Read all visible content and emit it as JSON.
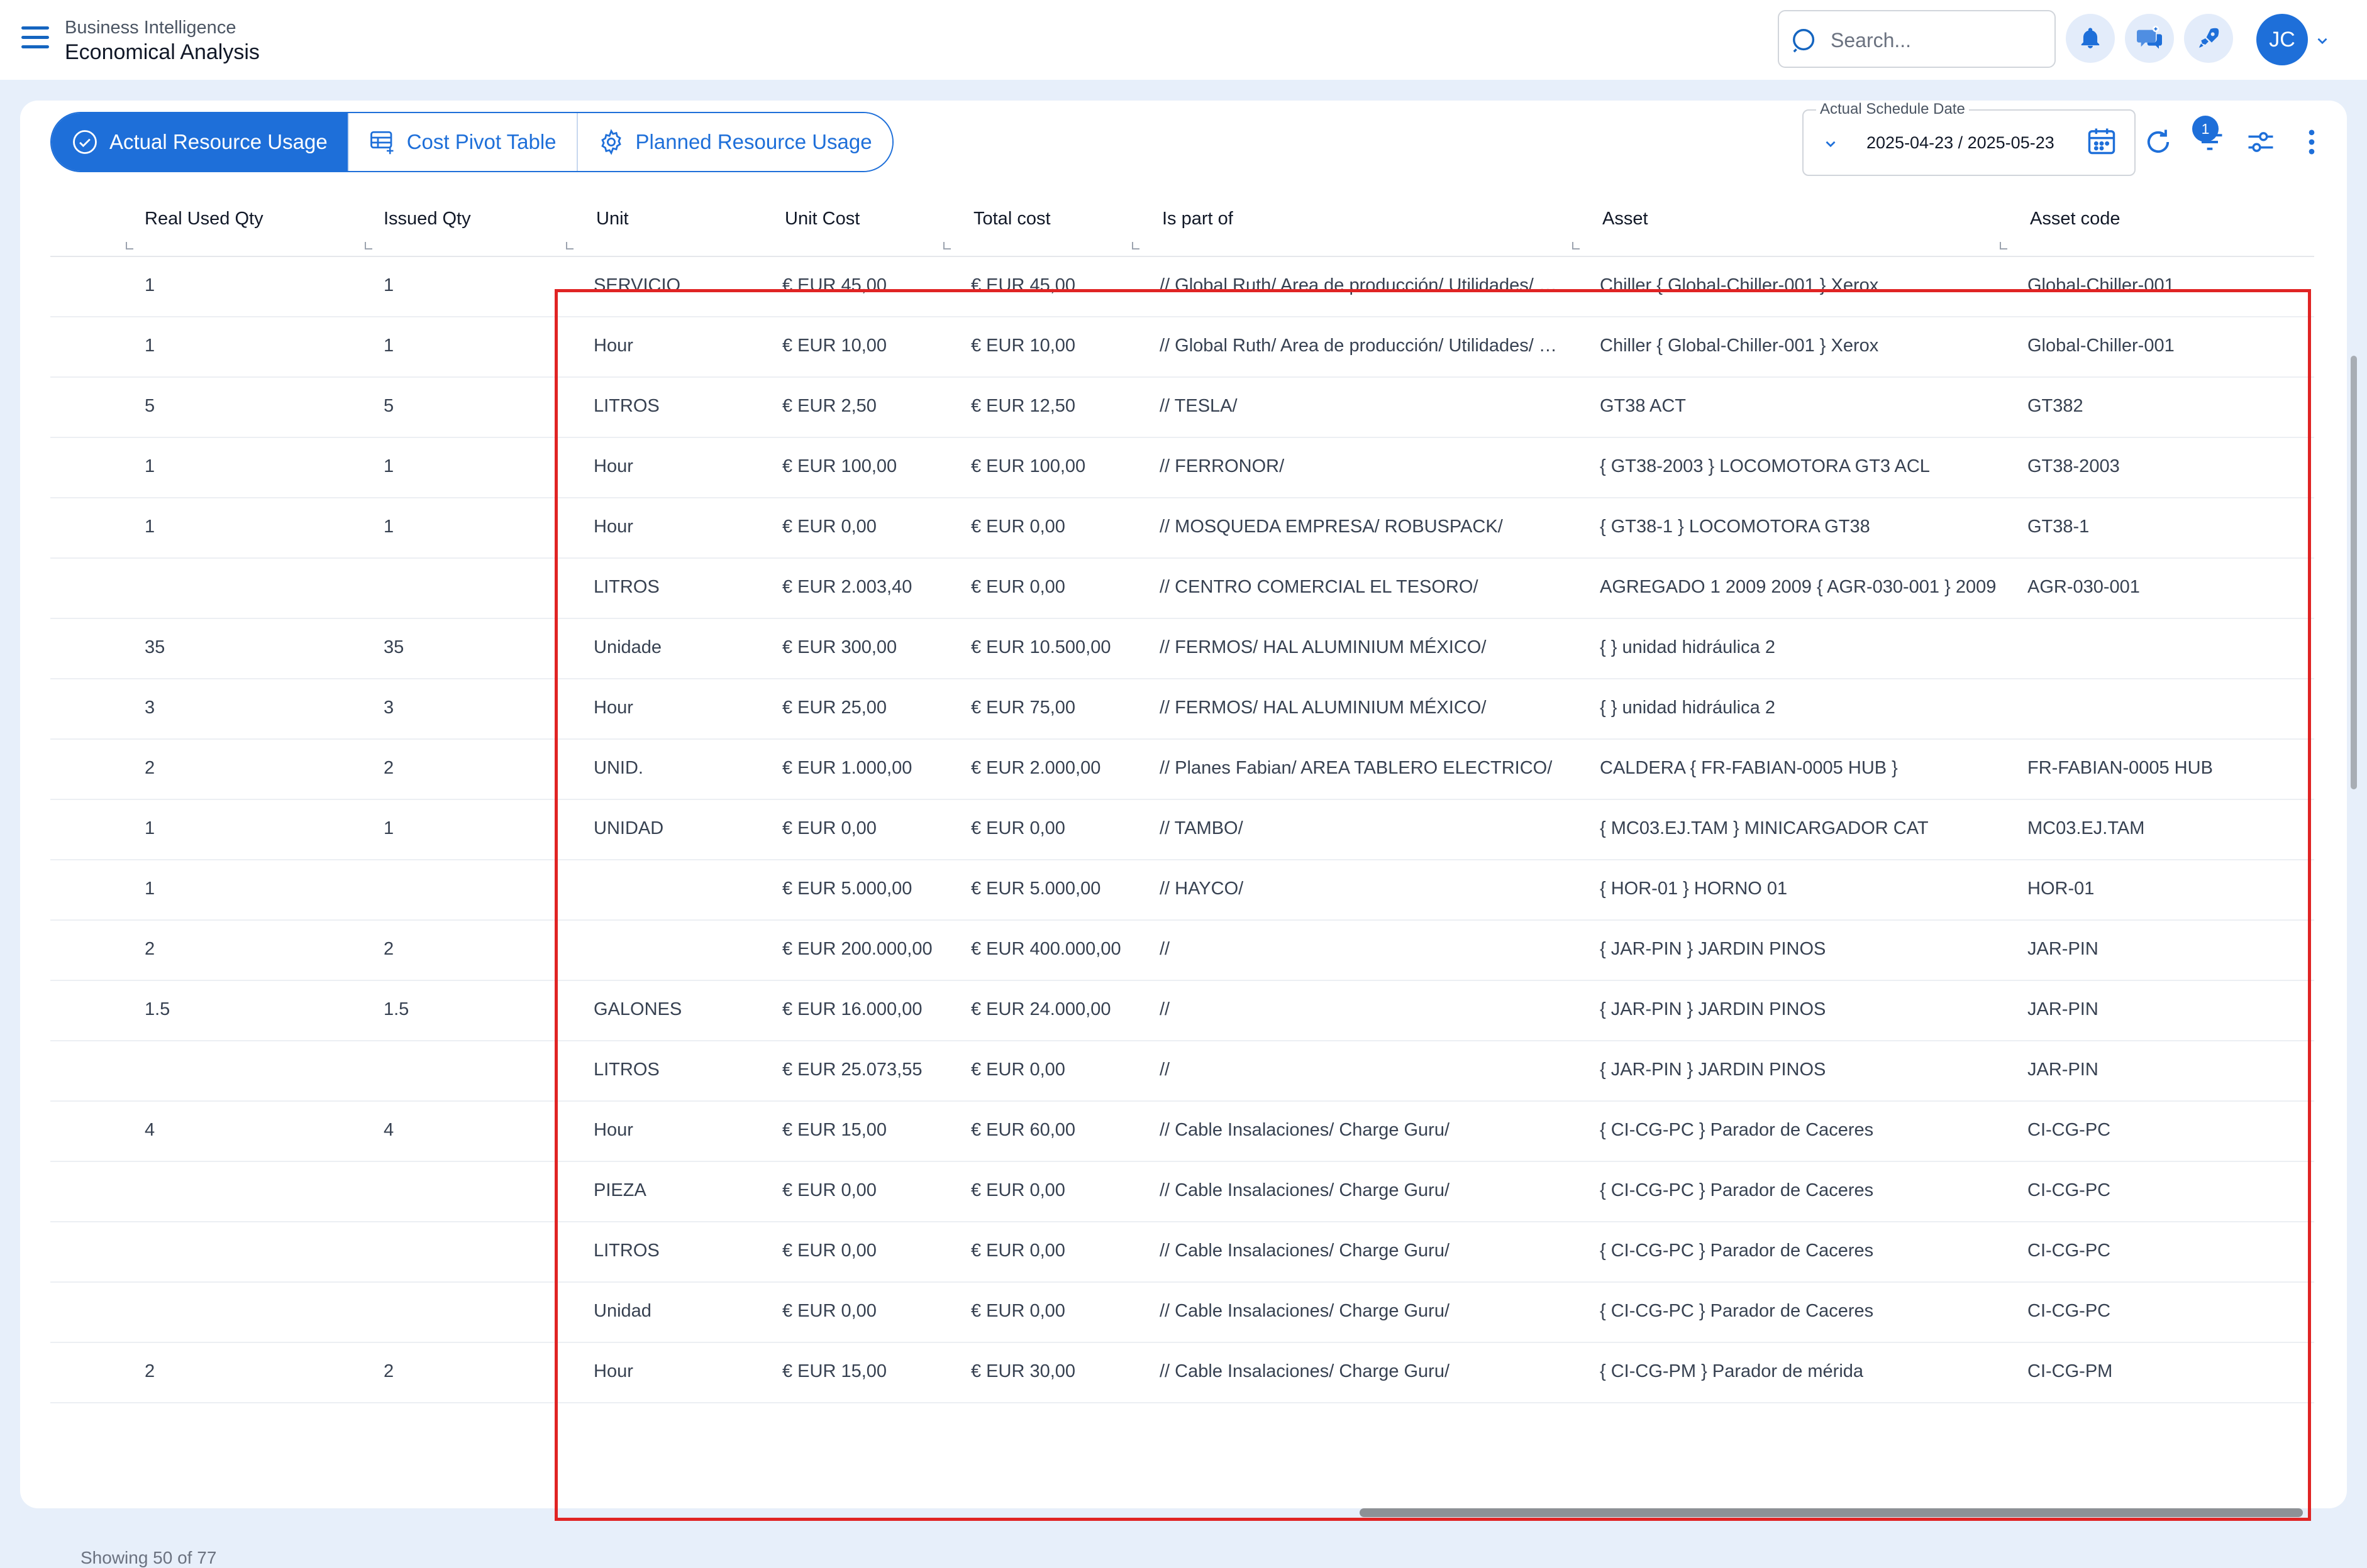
{
  "header": {
    "app_subtitle": "Business Intelligence",
    "app_title": "Economical Analysis",
    "search_placeholder": "Search...",
    "user_initials": "JC"
  },
  "tabs": [
    {
      "label": "Actual Resource Usage",
      "icon": "check-circle-icon",
      "active": true
    },
    {
      "label": "Cost Pivot Table",
      "icon": "pivot-table-icon",
      "active": false
    },
    {
      "label": "Planned Resource Usage",
      "icon": "gear-icon",
      "active": false
    }
  ],
  "toolbar": {
    "date_label": "Actual Schedule Date",
    "date_value": "2025-04-23 / 2025-05-23",
    "filter_count": "1"
  },
  "table": {
    "columns": [
      "Real Used Qty",
      "Issued Qty",
      "Unit",
      "Unit Cost",
      "Total cost",
      "Is part of",
      "Asset",
      "Asset code"
    ],
    "rows": [
      [
        "1",
        "1",
        "SERVICIO",
        "€ EUR 45,00",
        "€ EUR 45,00",
        "// Global Ruth/ Area de producción/ Utilidades/ Área de refrigeración/",
        "Chiller { Global-Chiller-001 } Xerox",
        "Global-Chiller-001"
      ],
      [
        "1",
        "1",
        "Hour",
        "€ EUR 10,00",
        "€ EUR 10,00",
        "// Global Ruth/ Area de producción/ Utilidades/ Área de refrigeración/",
        "Chiller { Global-Chiller-001 } Xerox",
        "Global-Chiller-001"
      ],
      [
        "5",
        "5",
        "LITROS",
        "€ EUR 2,50",
        "€ EUR 12,50",
        "// TESLA/",
        "GT38 ACT",
        "GT382"
      ],
      [
        "1",
        "1",
        "Hour",
        "€ EUR 100,00",
        "€ EUR 100,00",
        "// FERRONOR/",
        "{ GT38-2003 } LOCOMOTORA GT3 ACL",
        "GT38-2003"
      ],
      [
        "1",
        "1",
        "Hour",
        "€ EUR 0,00",
        "€ EUR 0,00",
        "// MOSQUEDA EMPRESA/ ROBUSPACK/",
        "{ GT38-1 } LOCOMOTORA GT38",
        "GT38-1"
      ],
      [
        "",
        "",
        "LITROS",
        "€ EUR 2.003,40",
        "€ EUR 0,00",
        "// CENTRO COMERCIAL EL TESORO/",
        "AGREGADO 1 2009 2009 { AGR-030-001 } 2009",
        "AGR-030-001"
      ],
      [
        "35",
        "35",
        "Unidade",
        "€ EUR 300,00",
        "€ EUR 10.500,00",
        "// FERMOS/ HAL ALUMINIUM MÉXICO/",
        "{ } unidad hidráulica 2",
        ""
      ],
      [
        "3",
        "3",
        "Hour",
        "€ EUR 25,00",
        "€ EUR 75,00",
        "// FERMOS/ HAL ALUMINIUM MÉXICO/",
        "{ } unidad hidráulica 2",
        ""
      ],
      [
        "2",
        "2",
        "UNID.",
        "€ EUR 1.000,00",
        "€ EUR 2.000,00",
        "// Planes Fabian/ AREA TABLERO ELECTRICO/",
        "CALDERA { FR-FABIAN-0005 HUB }",
        "FR-FABIAN-0005 HUB"
      ],
      [
        "1",
        "1",
        "UNIDAD",
        "€ EUR 0,00",
        "€ EUR 0,00",
        "// TAMBO/",
        "{ MC03.EJ.TAM } MINICARGADOR CAT",
        "MC03.EJ.TAM"
      ],
      [
        "1",
        "",
        "",
        "€ EUR 5.000,00",
        "€ EUR 5.000,00",
        "// HAYCO/",
        "{ HOR-01 } HORNO 01",
        "HOR-01"
      ],
      [
        "2",
        "2",
        "",
        "€ EUR 200.000,00",
        "€ EUR 400.000,00",
        "//",
        "{ JAR-PIN } JARDIN PINOS",
        "JAR-PIN"
      ],
      [
        "1.5",
        "1.5",
        "GALONES",
        "€ EUR 16.000,00",
        "€ EUR 24.000,00",
        "//",
        "{ JAR-PIN } JARDIN PINOS",
        "JAR-PIN"
      ],
      [
        "",
        "",
        "LITROS",
        "€ EUR 25.073,55",
        "€ EUR 0,00",
        "//",
        "{ JAR-PIN } JARDIN PINOS",
        "JAR-PIN"
      ],
      [
        "4",
        "4",
        "Hour",
        "€ EUR 15,00",
        "€ EUR 60,00",
        "// Cable Insalaciones/ Charge Guru/",
        "{ CI-CG-PC } Parador de Caceres",
        "CI-CG-PC"
      ],
      [
        "",
        "",
        "PIEZA",
        "€ EUR 0,00",
        "€ EUR 0,00",
        "// Cable Insalaciones/ Charge Guru/",
        "{ CI-CG-PC } Parador de Caceres",
        "CI-CG-PC"
      ],
      [
        "",
        "",
        "LITROS",
        "€ EUR 0,00",
        "€ EUR 0,00",
        "// Cable Insalaciones/ Charge Guru/",
        "{ CI-CG-PC } Parador de Caceres",
        "CI-CG-PC"
      ],
      [
        "",
        "",
        "Unidad",
        "€ EUR 0,00",
        "€ EUR 0,00",
        "// Cable Insalaciones/ Charge Guru/",
        "{ CI-CG-PC } Parador de Caceres",
        "CI-CG-PC"
      ],
      [
        "2",
        "2",
        "Hour",
        "€ EUR 15,00",
        "€ EUR 30,00",
        "// Cable Insalaciones/ Charge Guru/",
        "{ CI-CG-PM } Parador de mérida",
        "CI-CG-PM"
      ]
    ]
  },
  "footer": {
    "status": "Showing 50 of 77"
  },
  "colors": {
    "accent": "#1e6fd9",
    "highlight": "#e02424"
  }
}
